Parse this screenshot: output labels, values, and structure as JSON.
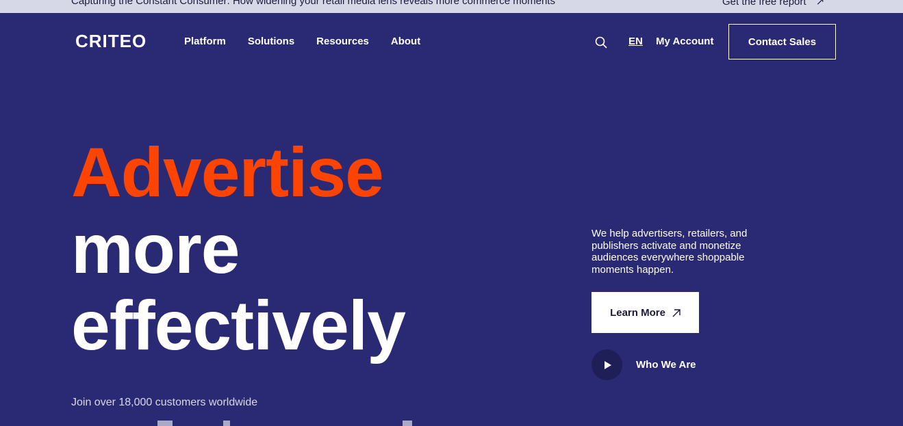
{
  "announcement": {
    "message": "Capturing the Constant Consumer: How widening your retail media lens reveals more commerce moments",
    "cta": "Get the free report"
  },
  "header": {
    "logo": "CRITEO",
    "nav": [
      "Platform",
      "Solutions",
      "Resources",
      "About"
    ],
    "language": "EN",
    "account": "My Account",
    "contact": "Contact Sales"
  },
  "hero": {
    "line1": "Advertise",
    "line2": "more",
    "line3": "effectively",
    "join": "Join over 18,000 customers worldwide",
    "description": "We help advertisers, retailers, and publishers activate and monetize audiences everywhere shoppable moments happen.",
    "learn_more": "Learn More",
    "who_we_are": "Who We Are"
  },
  "colors": {
    "background": "#2a2a74",
    "accent": "#ff4400",
    "announce_bg": "#d6d8e8"
  }
}
